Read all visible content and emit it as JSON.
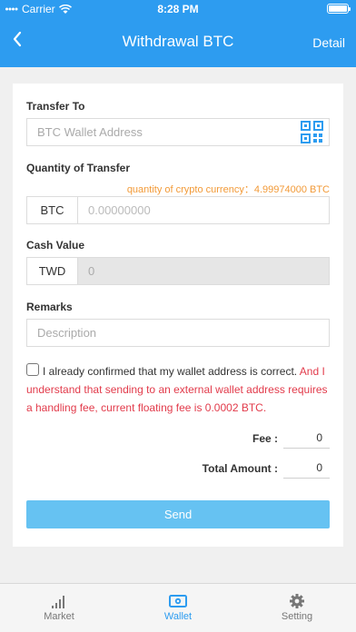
{
  "status_bar": {
    "carrier": "Carrier",
    "time": "8:28 PM",
    "battery_level": 1.0
  },
  "nav": {
    "back_icon": "chevron-left-icon",
    "title": "Withdrawal BTC",
    "detail_label": "Detail"
  },
  "form": {
    "transfer_to": {
      "label": "Transfer To",
      "placeholder": "BTC Wallet Address",
      "scan_icon": "qr-code-icon"
    },
    "quantity": {
      "label": "Quantity of Transfer",
      "available_label": "quantity of crypto currency：",
      "available_value": "4.99974000 BTC",
      "currency": "BTC",
      "placeholder": "0.00000000"
    },
    "cash_value": {
      "label": "Cash Value",
      "currency": "TWD",
      "value": "0"
    },
    "remarks": {
      "label": "Remarks",
      "placeholder": "Description"
    },
    "confirm": {
      "checked": false,
      "text_black": "I already confirmed that my wallet address is correct.",
      "text_red": "And I understand that sending to an external wallet address requires a handling fee, current floating fee is 0.0002 BTC."
    },
    "fee": {
      "label": "Fee :",
      "value": "0"
    },
    "total": {
      "label": "Total Amount :",
      "value": "0"
    },
    "send_label": "Send"
  },
  "tabs": [
    {
      "label": "Market",
      "icon": "signal-bars-icon",
      "active": false
    },
    {
      "label": "Wallet",
      "icon": "wallet-icon",
      "active": true
    },
    {
      "label": "Setting",
      "icon": "gear-icon",
      "active": false
    }
  ],
  "colors": {
    "primary": "#2d9cf0",
    "send_button": "#66c2f2",
    "warning_red": "#e23b4b",
    "orange": "#f29a38"
  }
}
